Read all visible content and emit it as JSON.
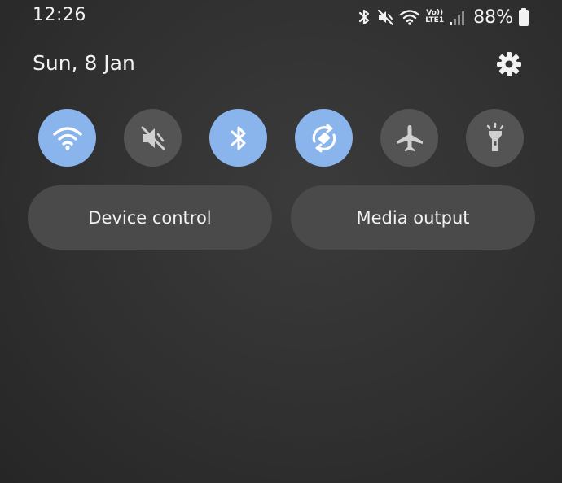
{
  "status_bar": {
    "time": "12:26",
    "network_label_top": "Vo))",
    "network_label_bottom": "LTE1",
    "battery_percent": "88%",
    "icons": [
      "bluetooth-icon",
      "mute-icon",
      "wifi-icon",
      "volte-lte-icon",
      "signal-icon",
      "battery-icon"
    ]
  },
  "header": {
    "date": "Sun, 8 Jan",
    "settings_icon": "gear-icon"
  },
  "quick_tiles": [
    {
      "name": "wifi",
      "icon": "wifi-icon",
      "state": "on"
    },
    {
      "name": "sound",
      "icon": "mute-icon",
      "state": "off"
    },
    {
      "name": "bluetooth",
      "icon": "bluetooth-icon",
      "state": "on"
    },
    {
      "name": "auto-rotate",
      "icon": "auto-rotate-icon",
      "state": "on"
    },
    {
      "name": "airplane-mode",
      "icon": "airplane-icon",
      "state": "off"
    },
    {
      "name": "flashlight",
      "icon": "flashlight-icon",
      "state": "off"
    }
  ],
  "buttons": {
    "device_control": "Device control",
    "media_output": "Media output"
  },
  "colors": {
    "tile_on": "#8ab4ec",
    "tile_off": "#545454",
    "pill_bg": "#4a4a4a"
  }
}
